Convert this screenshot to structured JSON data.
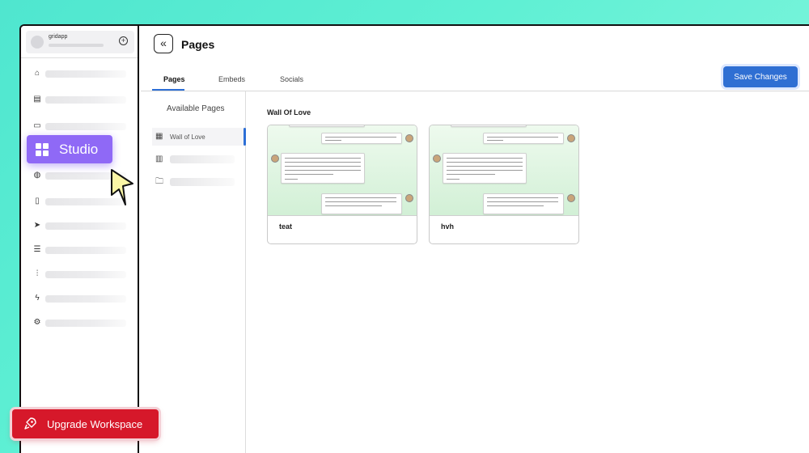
{
  "workspace": {
    "name": "gridapp",
    "add_icon": "plus-circle-icon"
  },
  "nav_icons": [
    "home-icon",
    "document-stack-icon",
    "studio-monitor-icon",
    "palette-icon",
    "file-icon",
    "send-icon",
    "server-icon",
    "bar-chart-icon",
    "lightning-icon",
    "gear-icon"
  ],
  "header": {
    "title": "Pages",
    "back_icon": "double-chevron-left-icon"
  },
  "tabs": [
    {
      "label": "Pages",
      "active": true
    },
    {
      "label": "Embeds",
      "active": false
    },
    {
      "label": "Socials",
      "active": false
    }
  ],
  "save_button": {
    "label": "Save Changes",
    "color": "#2f6fd3"
  },
  "sidebar": {
    "title": "Available Pages",
    "items": [
      {
        "label": "Wall of Love",
        "icon": "layout-check-icon",
        "active": true
      },
      {
        "label": "",
        "icon": "book-icon",
        "active": false
      },
      {
        "label": "",
        "icon": "folder-icon",
        "active": false
      }
    ]
  },
  "section": {
    "title": "Wall Of Love"
  },
  "cards": [
    {
      "name": "teat"
    },
    {
      "name": "hvh"
    }
  ],
  "overlay": {
    "studio_label": "Studio",
    "studio_color": "#8f69f6",
    "upgrade_label": "Upgrade Workspace",
    "upgrade_color": "#d6182a"
  }
}
